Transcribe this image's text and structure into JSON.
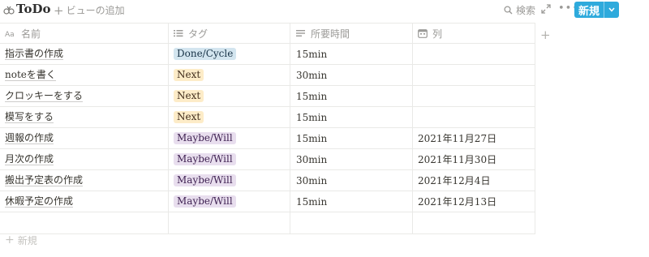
{
  "header": {
    "title": "ToDo",
    "add_view_label": "ビューの追加",
    "search_label": "検索",
    "new_button_label": "新規"
  },
  "columns": [
    {
      "label": "名前",
      "icon": "text-property-icon"
    },
    {
      "label": "タグ",
      "icon": "list-icon"
    },
    {
      "label": "所要時間",
      "icon": "lines-icon"
    },
    {
      "label": "列",
      "icon": "calendar-icon"
    }
  ],
  "rows": [
    {
      "name": "指示書の作成",
      "tag": "Done/Cycle",
      "tag_style": "done",
      "duration": "15min",
      "date": ""
    },
    {
      "name": "noteを書く",
      "tag": "Next",
      "tag_style": "next",
      "duration": "30min",
      "date": ""
    },
    {
      "name": "クロッキーをする",
      "tag": "Next",
      "tag_style": "next",
      "duration": "15min",
      "date": ""
    },
    {
      "name": "模写をする",
      "tag": "Next",
      "tag_style": "next",
      "duration": "15min",
      "date": ""
    },
    {
      "name": "週報の作成",
      "tag": "Maybe/Will",
      "tag_style": "maybe",
      "duration": "15min",
      "date": "2021年11月27日"
    },
    {
      "name": "月次の作成",
      "tag": "Maybe/Will",
      "tag_style": "maybe",
      "duration": "30min",
      "date": "2021年11月30日"
    },
    {
      "name": "搬出予定表の作成",
      "tag": "Maybe/Will",
      "tag_style": "maybe",
      "duration": "30min",
      "date": "2021年12月4日"
    },
    {
      "name": "休暇予定の作成",
      "tag": "Maybe/Will",
      "tag_style": "maybe",
      "duration": "15min",
      "date": "2021年12月13日"
    }
  ],
  "new_row_label": "新規",
  "colors": {
    "accent": "#2eaadc",
    "tag_done_bg": "#d3e5ef",
    "tag_next_bg": "#fdecc8",
    "tag_maybe_bg": "#e8deee"
  }
}
